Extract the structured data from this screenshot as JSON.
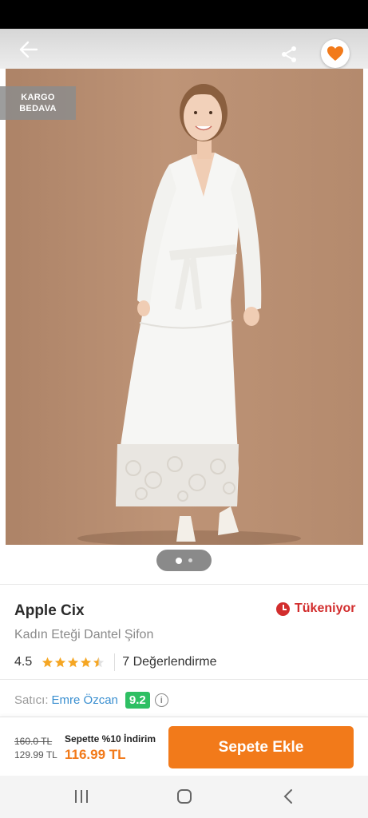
{
  "header": {
    "back_icon": "arrow-left-icon",
    "share_icon": "share-icon",
    "favorite_icon": "heart-icon",
    "favorite_color": "#f27a1a"
  },
  "image": {
    "badge_line1": "KARGO",
    "badge_line2": "BEDAVA",
    "slide_count": 2,
    "active_slide": 1
  },
  "product": {
    "brand": "Apple Cix",
    "stock_status": "Tükeniyor",
    "name": "Kadın Eteği Dantel Şifon",
    "rating": "4.5",
    "rating_value": 4.5,
    "review_count": "7 Değerlendirme"
  },
  "seller": {
    "label": "Satıcı:",
    "name": "Emre Özcan",
    "score": "9.2",
    "info_icon": "info-icon"
  },
  "pricing": {
    "old_price": "160.0 TL",
    "mid_price": "129.99 TL",
    "promo_label": "Sepette %10 İndirim",
    "final_price": "116.99 TL"
  },
  "actions": {
    "add_to_cart": "Sepete Ekle"
  },
  "colors": {
    "accent": "#f27a1a",
    "stock_warning": "#d22d2d",
    "seller_link": "#3a8fd0",
    "score_badge": "#2ebf63"
  },
  "system_nav": {
    "recent_icon": "recent-apps-icon",
    "home_icon": "home-icon",
    "back_icon": "back-chevron-icon"
  }
}
